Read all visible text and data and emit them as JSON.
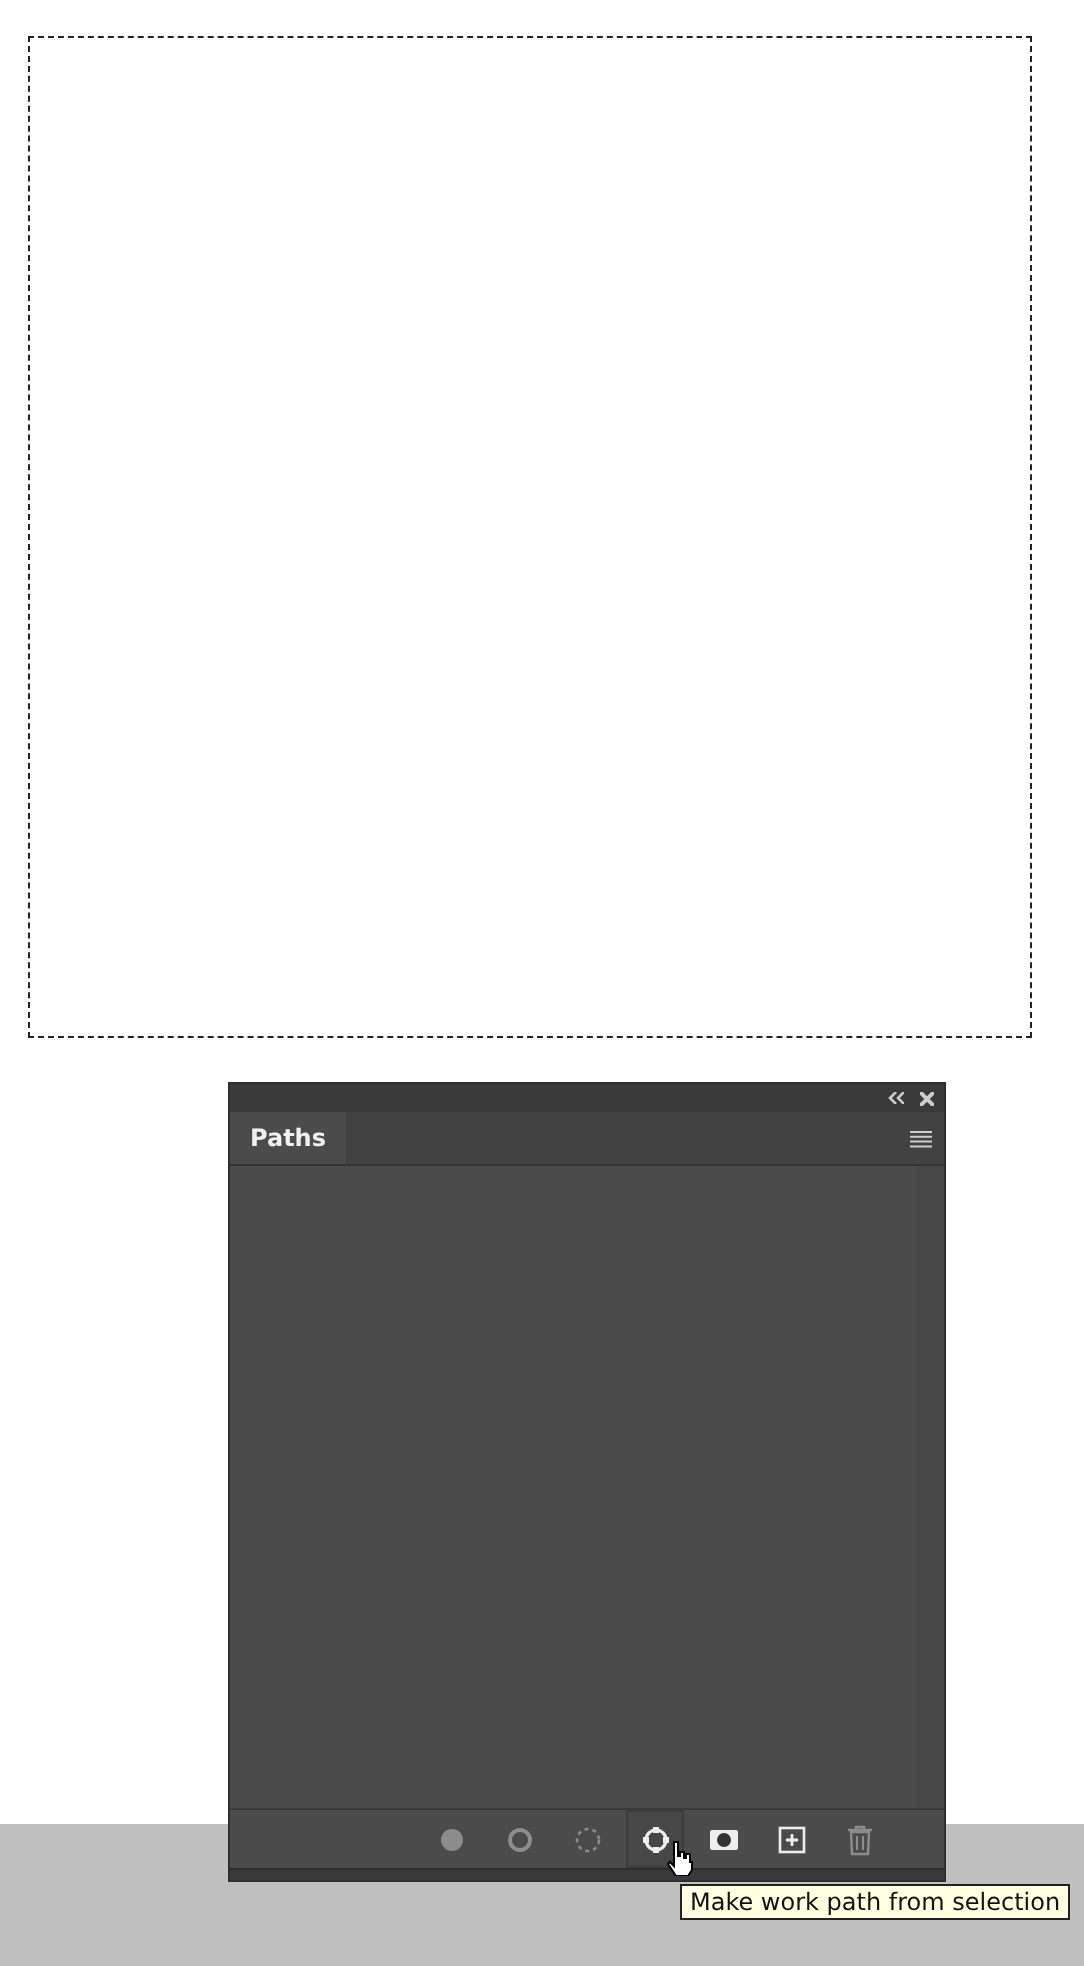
{
  "panel": {
    "tab": {
      "label": "Paths",
      "selected": true
    },
    "buttons": [
      {
        "kind": "fill",
        "disabled": true,
        "hovered": false
      },
      {
        "kind": "stroke",
        "disabled": true,
        "hovered": false
      },
      {
        "kind": "load-selection",
        "disabled": true,
        "hovered": false
      },
      {
        "kind": "work-path",
        "disabled": false,
        "hovered": true
      },
      {
        "kind": "mask",
        "disabled": false,
        "hovered": false
      },
      {
        "kind": "new",
        "disabled": false,
        "hovered": false
      },
      {
        "kind": "delete",
        "disabled": true,
        "hovered": false
      }
    ]
  },
  "tooltip": {
    "text": "Make work path from selection"
  }
}
